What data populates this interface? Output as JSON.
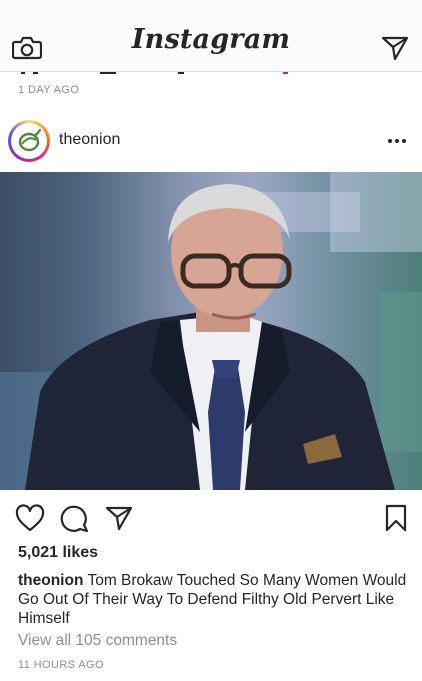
{
  "header": {
    "title": "Instagram",
    "camera_icon": "camera-icon",
    "direct_icon": "paper-plane-icon"
  },
  "previous_post": {
    "timestamp": "1 DAY AGO"
  },
  "post": {
    "username": "theonion",
    "avatar_icon": "onion-logo",
    "more_icon": "more-options-icon",
    "photo_alt": "Tom Brokaw photo",
    "actions": {
      "like_icon": "heart-icon",
      "comment_icon": "comment-icon",
      "share_icon": "paper-plane-icon",
      "save_icon": "bookmark-icon"
    },
    "likes": "5,021 likes",
    "caption_username": "theonion",
    "caption_text": "Tom Brokaw Touched So Many Women Would Go Out Of Their Way To Defend Filthy Old Pervert Like Himself",
    "view_comments": "View all 105 comments",
    "timestamp": "11 HOURS AGO"
  },
  "colors": {
    "text": "#262626",
    "muted": "#8e8e8e",
    "border": "#dbdbdb",
    "onion_green": "#4a8a3a"
  }
}
